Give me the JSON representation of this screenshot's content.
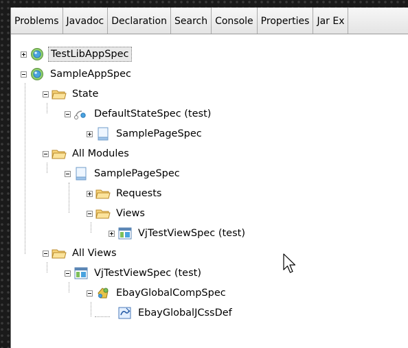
{
  "tabs": [
    "Problems",
    "Javadoc",
    "Declaration",
    "Search",
    "Console",
    "Properties",
    "Jar Ex"
  ],
  "tree": [
    {
      "label": "TestLibAppSpec",
      "icon": "globe-icon",
      "expander": "plus"
    },
    {
      "label": "SampleAppSpec",
      "icon": "globe-icon",
      "expander": "minus"
    },
    {
      "label": "State",
      "icon": "folder-icon",
      "expander": "minus"
    },
    {
      "label": "DefaultStateSpec (test)",
      "icon": "state-icon",
      "expander": "minus"
    },
    {
      "label": "SamplePageSpec",
      "icon": "page-icon",
      "expander": "plus"
    },
    {
      "label": "All Modules",
      "icon": "folder-icon",
      "expander": "minus"
    },
    {
      "label": "SamplePageSpec",
      "icon": "page-icon",
      "expander": "minus"
    },
    {
      "label": "Requests",
      "icon": "folder-icon",
      "expander": "plus"
    },
    {
      "label": "Views",
      "icon": "folder-icon",
      "expander": "minus"
    },
    {
      "label": "VjTestViewSpec (test)",
      "icon": "view-icon",
      "expander": "plus"
    },
    {
      "label": "All Views",
      "icon": "folder-icon",
      "expander": "minus"
    },
    {
      "label": "VjTestViewSpec (test)",
      "icon": "view-icon",
      "expander": "minus"
    },
    {
      "label": "EbayGlobalCompSpec",
      "icon": "component-icon",
      "expander": "minus"
    },
    {
      "label": "EbayGlobalJCssDef",
      "icon": "css-def-icon",
      "expander": "none"
    }
  ]
}
